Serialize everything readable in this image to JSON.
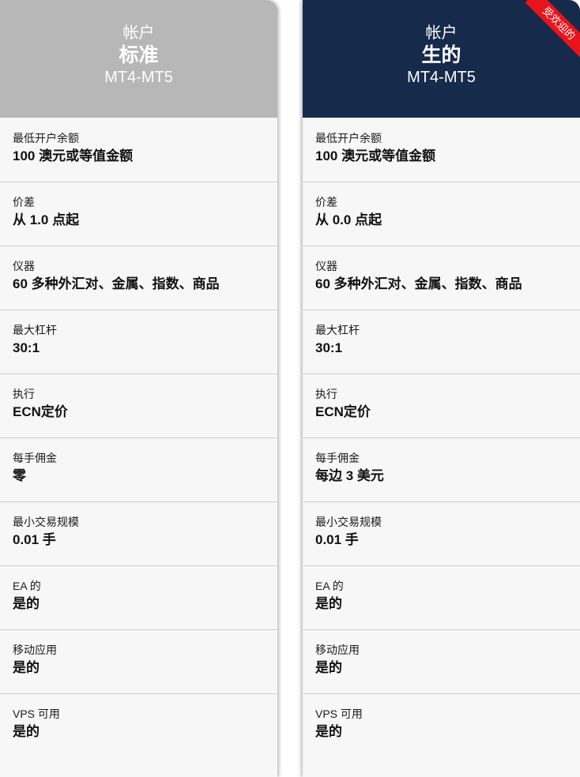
{
  "colors": {
    "standard_header": "#b7b7b7",
    "raw_header": "#162a4b",
    "ribbon": "#e8141c",
    "card_background": "#f7f7f7"
  },
  "accounts": [
    {
      "account_label": "帐户",
      "name": "标准",
      "platform": "MT4-MT5",
      "rows": [
        {
          "label": "最低开户余额",
          "value": "100 澳元或等值金额"
        },
        {
          "label": "价差",
          "value": "从 1.0 点起"
        },
        {
          "label": "仪器",
          "value": "60 多种外汇对、金属、指数、商品"
        },
        {
          "label": "最大杠杆",
          "value": "30:1"
        },
        {
          "label": "执行",
          "value": "ECN定价"
        },
        {
          "label": "每手佣金",
          "value": "零"
        },
        {
          "label": "最小交易规模",
          "value": "0.01 手"
        },
        {
          "label": "EA 的",
          "value": "是的"
        },
        {
          "label": "移动应用",
          "value": "是的"
        },
        {
          "label": "VPS 可用",
          "value": "是的"
        }
      ]
    },
    {
      "account_label": "帐户",
      "name": "生的",
      "platform": "MT4-MT5",
      "ribbon": "受欢迎的",
      "rows": [
        {
          "label": "最低开户余额",
          "value": "100 澳元或等值金额"
        },
        {
          "label": "价差",
          "value": "从 0.0 点起"
        },
        {
          "label": "仪器",
          "value": "60 多种外汇对、金属、指数、商品"
        },
        {
          "label": "最大杠杆",
          "value": "30:1"
        },
        {
          "label": "执行",
          "value": "ECN定价"
        },
        {
          "label": "每手佣金",
          "value": "每边 3 美元"
        },
        {
          "label": "最小交易规模",
          "value": "0.01 手"
        },
        {
          "label": "EA 的",
          "value": "是的"
        },
        {
          "label": "移动应用",
          "value": "是的"
        },
        {
          "label": "VPS 可用",
          "value": "是的"
        }
      ]
    }
  ]
}
